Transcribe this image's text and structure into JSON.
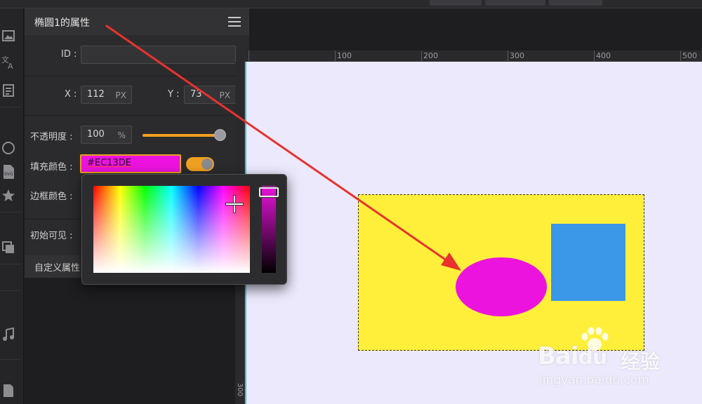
{
  "panel": {
    "title": "椭圆1的属性",
    "menu_icon": "hamburger-menu-icon",
    "id_label": "ID :",
    "id_value": "",
    "x_label": "X :",
    "x_value": "112",
    "x_unit": "PX",
    "y_label": "Y :",
    "y_value": "73",
    "y_unit": "PX",
    "opacity_label": "不透明度 :",
    "opacity_value": "100",
    "opacity_unit": "%",
    "opacity_level": 1.0,
    "fill_label": "填充颜色 :",
    "fill_value": "#EC13DE",
    "fill_enabled": true,
    "border_label": "边框颜色 :",
    "visible_label": "初始可见 :",
    "custom_label": "自定义属性"
  },
  "rail_icons": [
    "image-icon",
    "translate-icon",
    "text-doc-icon",
    "circle-icon",
    "svg-file-icon",
    "star-icon",
    "layers-icon",
    "music-icon",
    "file-icon"
  ],
  "color_picker": {
    "selected_color": "#EC13DE",
    "cursor_icon": "crosshair-icon"
  },
  "ruler": {
    "labels": [
      "100",
      "200",
      "300",
      "400",
      "500"
    ]
  },
  "vruler": {
    "label": "300"
  },
  "canvas": {
    "background": "#ece9fd",
    "shapes": [
      {
        "name": "yellow-rectangle",
        "color": "#ffef3a"
      },
      {
        "name": "ellipse",
        "color": "#EC13DE"
      },
      {
        "name": "blue-rectangle",
        "color": "#3b97e8"
      }
    ]
  },
  "watermark": {
    "logo": "Bai",
    "logo_rest": "du",
    "suffix": "经验",
    "url": "jingyan.baidu.com"
  },
  "colors": {
    "accent": "#f0a020",
    "annotation_arrow": "#e8322e"
  }
}
